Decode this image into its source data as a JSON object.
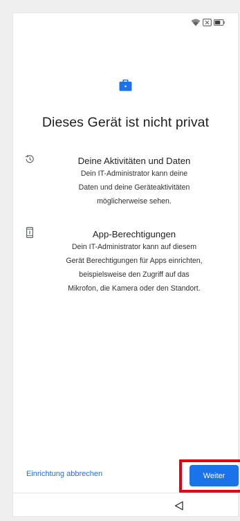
{
  "status_bar": {
    "icons": [
      "wifi-icon",
      "sim-no-signal-icon",
      "battery-icon"
    ]
  },
  "header": {
    "icon": "briefcase-icon",
    "title": "Dieses Gerät ist nicht privat"
  },
  "sections": [
    {
      "icon": "history-icon",
      "heading": "Deine Aktivitäten und Daten",
      "body_lines": [
        "Dein IT-Administrator kann deine",
        "Daten und deine Geräteaktivitäten",
        "möglicherweise sehen."
      ]
    },
    {
      "icon": "phone-device-icon",
      "heading": "App-Berechtigungen",
      "body_lines": [
        "Dein IT-Administrator kann auf diesem",
        "Gerät Berechtigungen für Apps einrichten,",
        "beispielsweise den Zugriff auf das",
        "Mikrofon, die Kamera oder den Standort."
      ]
    }
  ],
  "footer": {
    "cancel_label": "Einrichtung abbrechen",
    "next_label": "Weiter"
  },
  "navigation": {
    "back_icon": "back-triangle-icon"
  },
  "colors": {
    "accent": "#1a73e8",
    "highlight": "#e3000f",
    "background": "#ffffff"
  }
}
